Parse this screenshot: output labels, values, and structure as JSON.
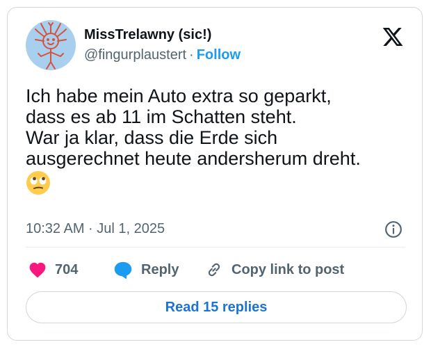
{
  "author": {
    "display_name": "MissTrelawny (sic!)",
    "handle": "@fingurplaustert",
    "separator": "·",
    "follow_label": "Follow",
    "avatar_icon": "stick-figure-drawing-avatar"
  },
  "tweet": {
    "lines": [
      "Ich habe mein Auto extra so geparkt,",
      "dass es ab 11 im Schatten steht.",
      "War ja klar, dass die Erde sich",
      "ausgerechnet heute andersherum dreht."
    ],
    "emoji": "face-with-rolling-eyes-emoji",
    "timestamp": "10:32 AM · Jul 1, 2025"
  },
  "actions": {
    "like_count": "704",
    "reply_label": "Reply",
    "copy_label": "Copy link to post"
  },
  "read_replies_label": "Read 15 replies",
  "colors": {
    "accent": "#1d9bf0",
    "heart": "#f91880",
    "muted": "#536471",
    "border": "#cfd9de"
  }
}
